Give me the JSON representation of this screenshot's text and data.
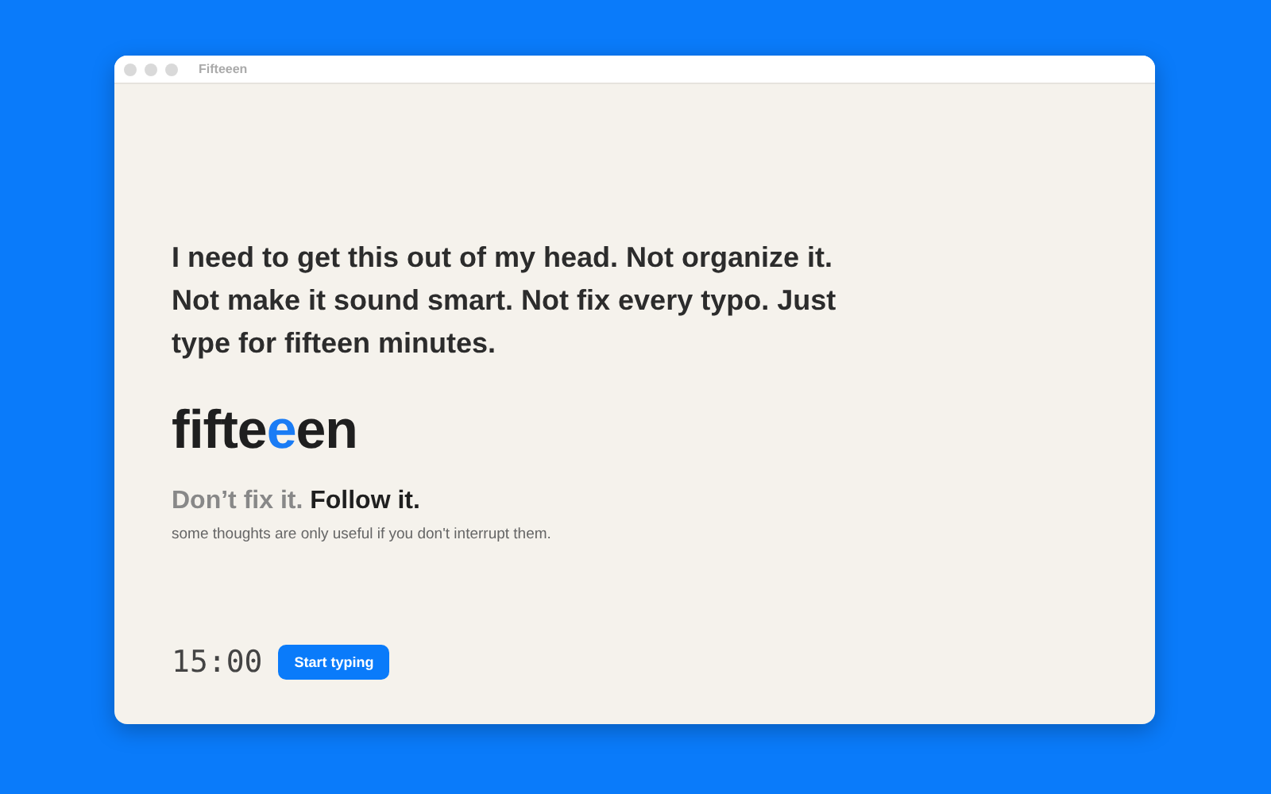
{
  "window": {
    "title": "Fifteeen"
  },
  "intro": "I need to get this out of my head. Not organize it. Not make it sound smart. Not fix every typo. Just type for fifteen minutes.",
  "logo": [
    {
      "text": "fifte",
      "accent": false
    },
    {
      "text": "e",
      "accent": true
    },
    {
      "text": "en",
      "accent": false
    }
  ],
  "tagline": [
    {
      "text": "Don’t fix it.",
      "emphasis": false
    },
    {
      "text": "Follow it.",
      "emphasis": true
    }
  ],
  "subtitle": "some thoughts are only useful if you don't interrupt them.",
  "timer": "15:00",
  "start_button": "Start typing"
}
